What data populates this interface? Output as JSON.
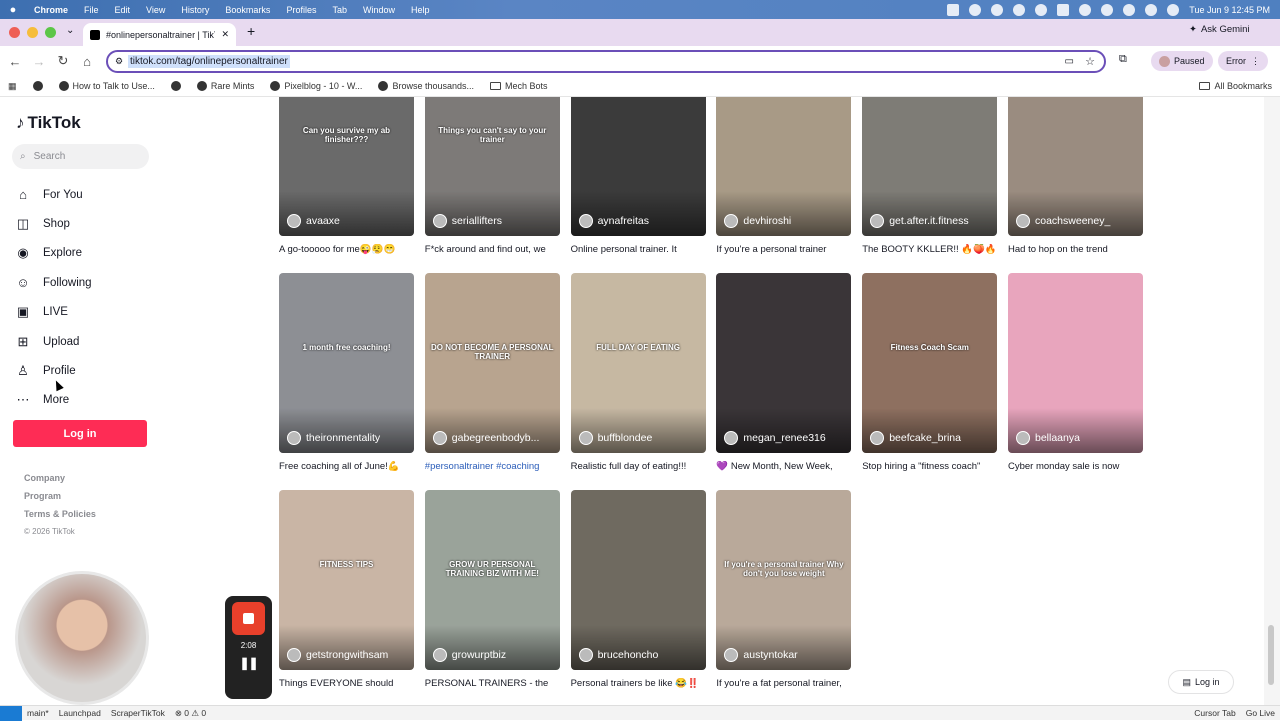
{
  "menubar": {
    "app": "Chrome",
    "items": [
      "File",
      "Edit",
      "View",
      "History",
      "Bookmarks",
      "Profiles",
      "Tab",
      "Window",
      "Help"
    ],
    "clock": "Tue Jun 9  12:45 PM"
  },
  "browser": {
    "tab_title": "#onlinepersonaltrainer | TikTo",
    "ask_gemini": "Ask Gemini",
    "url": "tiktok.com/tag/onlinepersonaltrainer",
    "profile_label": "Paused",
    "error_label": "Error",
    "bookmarks": [
      "How to Talk to Use...",
      "Rare Mints",
      "Pixelblog - 10 - W...",
      "Browse thousands...",
      "Mech Bots"
    ],
    "all_bookmarks": "All Bookmarks"
  },
  "sidebar": {
    "logo": "TikTok",
    "search_placeholder": "Search",
    "nav": [
      {
        "label": "For You",
        "icon": "home-icon"
      },
      {
        "label": "Shop",
        "icon": "shopping-bag-icon"
      },
      {
        "label": "Explore",
        "icon": "compass-icon"
      },
      {
        "label": "Following",
        "icon": "user-check-icon"
      },
      {
        "label": "LIVE",
        "icon": "live-icon"
      },
      {
        "label": "Upload",
        "icon": "plus-square-icon"
      },
      {
        "label": "Profile",
        "icon": "person-icon"
      },
      {
        "label": "More",
        "icon": "more-dots-icon"
      }
    ],
    "login": "Log in",
    "footer": [
      "Company",
      "Program",
      "Terms & Policies"
    ],
    "copyright": "© 2026 TikTok"
  },
  "recorder": {
    "time": "2:08"
  },
  "videos": [
    {
      "author": "avaaxe",
      "caption": "A go-tooooo for me😜😮‍💨😁",
      "overlay": "Can you survive my ab finisher???",
      "color": "#6a6a6a"
    },
    {
      "author": "seriallifters",
      "caption": "F*ck around and find out, we",
      "overlay": "Things you can't say to your trainer",
      "color": "#7d7a78"
    },
    {
      "author": "aynafreitas",
      "caption": "Online personal trainer. It",
      "overlay": "",
      "color": "#3b3b3b"
    },
    {
      "author": "devhiroshi",
      "caption": "If you're a personal trainer",
      "overlay": "",
      "color": "#a89a86"
    },
    {
      "author": "get.after.it.fitness",
      "caption": "The BOOTY KKLLER!! 🔥🍑🔥",
      "overlay": "",
      "color": "#7e7c76"
    },
    {
      "author": "coachsweeney_",
      "caption": "Had to hop on the trend",
      "overlay": "",
      "color": "#9a8c80"
    },
    {
      "author": "theironmentality",
      "caption": "Free coaching all of June!💪",
      "overlay": "1 month free coaching!",
      "color": "#8d8f94"
    },
    {
      "author": "gabegreenbodyb...",
      "caption": "#personaltrainer #coaching",
      "overlay": "DO NOT BECOME A PERSONAL TRAINER",
      "color": "#b8a48f",
      "link": true
    },
    {
      "author": "buffblondee",
      "caption": "Realistic full day of eating!!!",
      "overlay": "FULL DAY OF EATING",
      "color": "#c6b8a2"
    },
    {
      "author": "megan_renee316",
      "caption": "💜 New Month, New Week,",
      "overlay": "",
      "color": "#3a3538"
    },
    {
      "author": "beefcake_brina",
      "caption": "Stop hiring a \"fitness coach\"",
      "overlay": "Fitness Coach Scam",
      "color": "#8e7060"
    },
    {
      "author": "bellaanya",
      "caption": "Cyber monday sale is now",
      "overlay": "",
      "color": "#e8a5bd"
    },
    {
      "author": "getstrongwithsam",
      "caption": "Things EVERYONE should",
      "overlay": "FITNESS TIPS",
      "color": "#c9b5a5"
    },
    {
      "author": "growurptbiz",
      "caption": "PERSONAL TRAINERS - the",
      "overlay": "GROW UR PERSONAL TRAINING BIZ WITH ME!",
      "color": "#9aa39a"
    },
    {
      "author": "brucehoncho",
      "caption": "Personal trainers be like 😂‼️",
      "overlay": "",
      "color": "#6f6a60"
    },
    {
      "author": "austyntokar",
      "caption": "If you're a fat personal trainer,",
      "overlay": "If you're a personal trainer Why don't you lose weight",
      "color": "#b9a99a"
    }
  ],
  "floating_login": "Log in",
  "statusbar": {
    "left": [
      "main*",
      "Launchpad",
      "ScraperTikTok",
      "⊗ 0 ⚠ 0"
    ],
    "right": [
      "Cursor Tab",
      "Go Live"
    ]
  }
}
